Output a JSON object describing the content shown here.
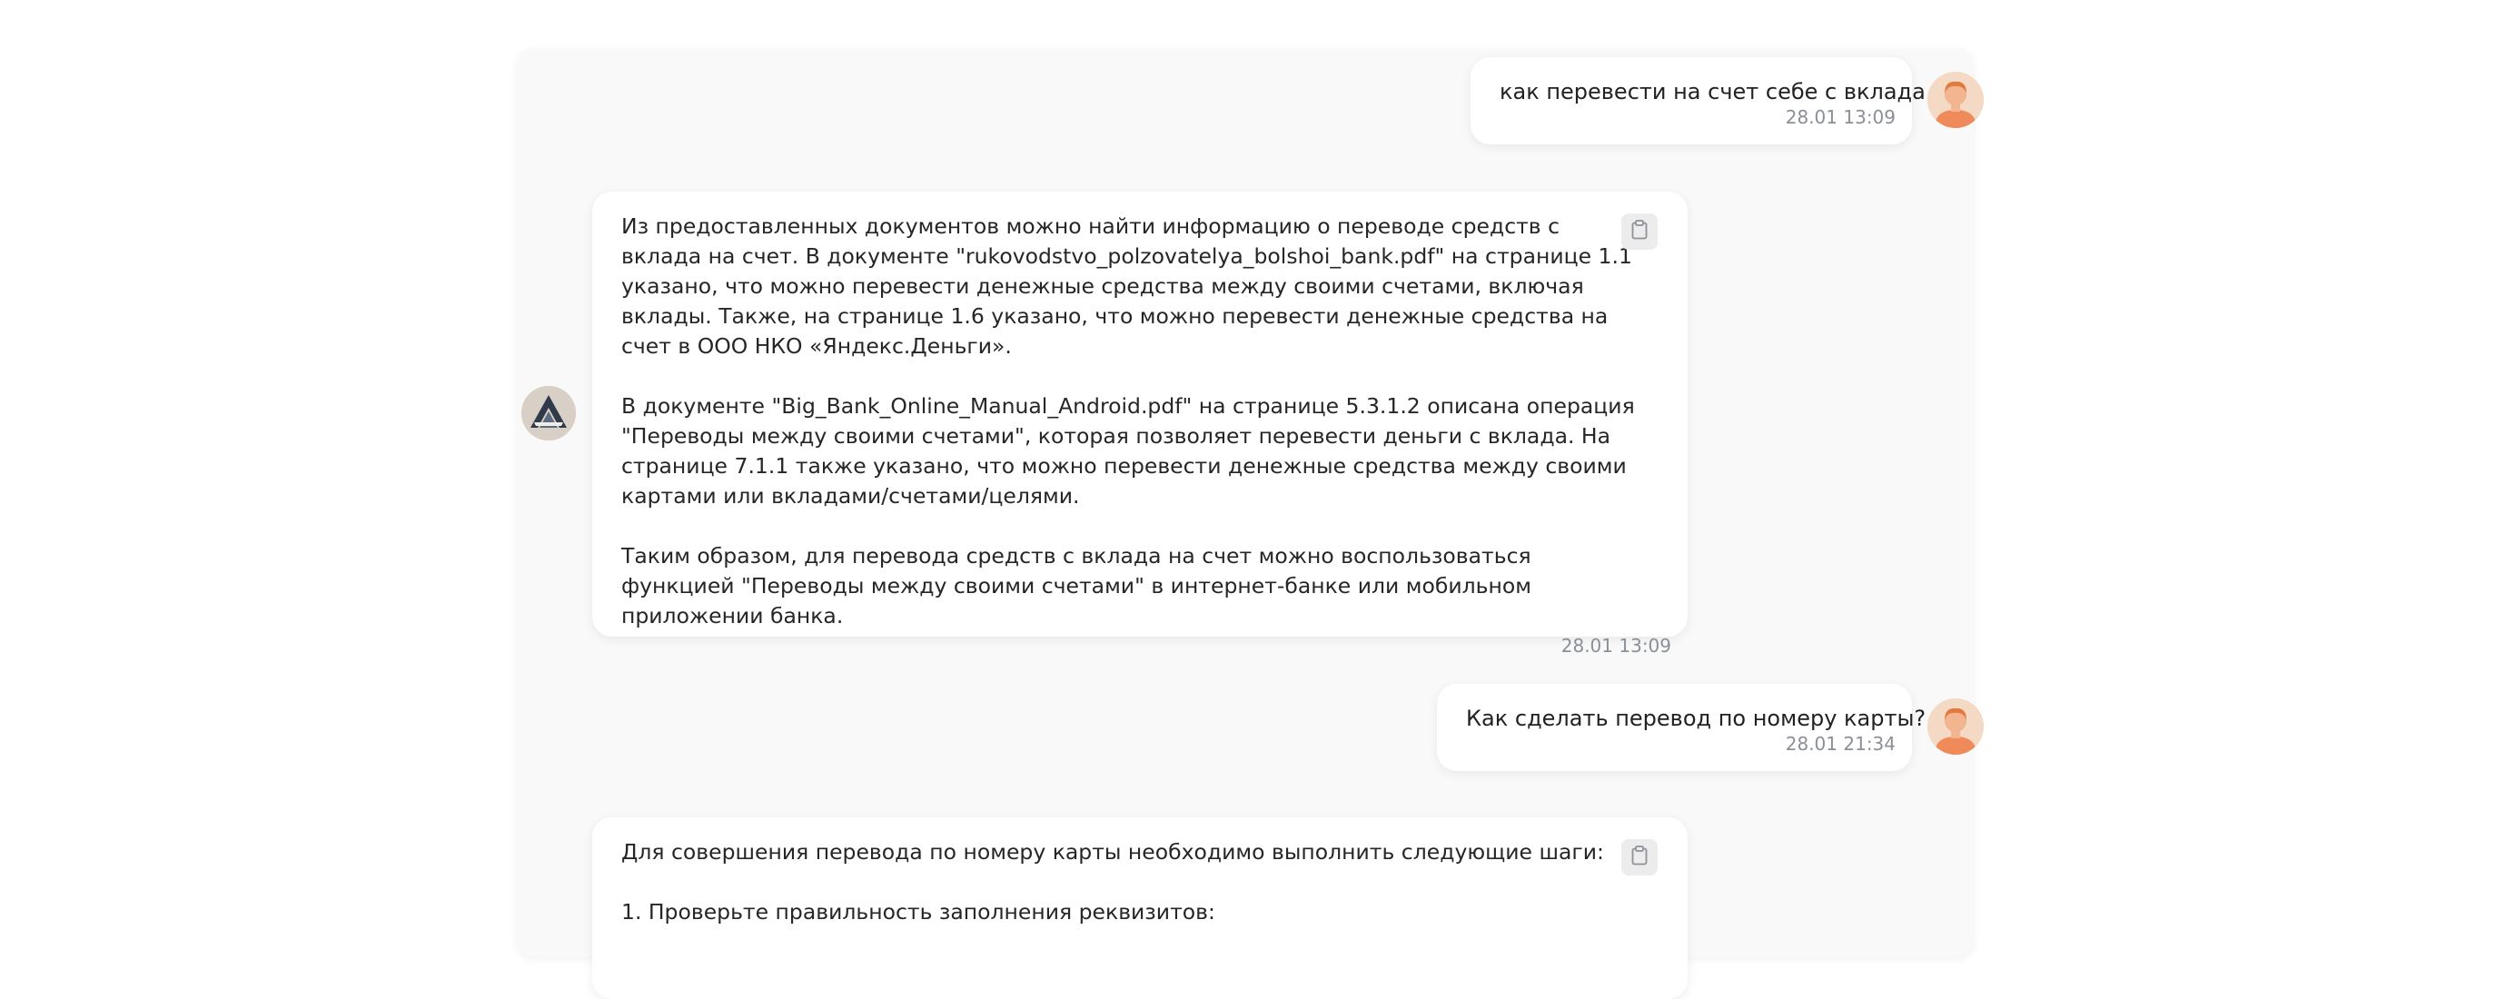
{
  "messages": [
    {
      "role": "user",
      "text": "как перевести на счет себе с вклада",
      "time": "28.01 13:09"
    },
    {
      "role": "assistant",
      "paragraphs": [
        "Из предоставленных документов можно найти информацию о переводе средств с вклада на счет. В документе \"rukovodstvo_polzovatelya_bolshoi_bank.pdf\" на странице 1.1 указано, что можно перевести денежные средства между своими счетами, включая вклады. Также, на странице 1.6 указано, что можно перевести денежные средства на счет в ООО НКО «Яндекс.Деньги».",
        "В документе \"Big_Bank_Online_Manual_Android.pdf\" на странице 5.3.1.2 описана операция \"Переводы между своими счетами\", которая позволяет перевести деньги с вклада. На странице 7.1.1 также указано, что можно перевести денежные средства между своими картами или вкладами/счетами/целями.",
        "Таким образом, для перевода средств с вклада на счет можно воспользоваться функцией \"Переводы между своими счетами\" в интернет-банке или мобильном приложении банка."
      ],
      "time": "28.01 13:09"
    },
    {
      "role": "user",
      "text": "Как сделать перевод по номеру карты?",
      "time": "28.01 21:34"
    },
    {
      "role": "assistant",
      "paragraphs": [
        "Для совершения перевода по номеру карты необходимо выполнить следующие шаги:",
        "1. Проверьте правильность заполнения реквизитов:"
      ]
    }
  ],
  "icons": {
    "copy": "clipboard-icon",
    "user_avatar": "user-avatar-icon",
    "bot_avatar": "bot-logo-icon"
  },
  "colors": {
    "panel_bg": "#f9f9f9",
    "bubble_bg": "#ffffff",
    "timestamp": "#8a8f98",
    "avatar_skin": "#f4d9c4",
    "avatar_shirt": "#ef8a5a"
  }
}
